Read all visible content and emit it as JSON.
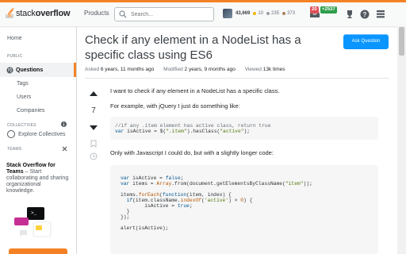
{
  "header": {
    "logo_text_plain": "stack",
    "logo_text_bold": "overflow",
    "products_label": "Products",
    "search_placeholder": "Search...",
    "reputation": "43,669",
    "gold": "10",
    "silver": "235",
    "bronze": "373",
    "inbox_badge": "20",
    "achievements_badge": "+2537",
    "colors": {
      "accent": "#f48225",
      "gold": "#f1b600",
      "silver": "#9a9ea3",
      "bronze": "#ab825f",
      "red": "#de4f54",
      "green": "#2e9e4a"
    }
  },
  "sidebar": {
    "home": "Home",
    "public_heading": "PUBLIC",
    "questions": "Questions",
    "tags": "Tags",
    "users": "Users",
    "companies": "Companies",
    "collectives_heading": "COLLECTIVES",
    "explore_collectives": "Explore Collectives",
    "teams_heading": "TEAMS",
    "teams_title": "Stack Overflow for Teams",
    "teams_desc": " – Start collaborating and sharing organizational knowledge."
  },
  "question": {
    "title": "Check if any element in a NodeList has a specific class using ES6",
    "ask_button": "Ask Question",
    "asked_label": "Asked",
    "asked_value": "6 years, 11 months ago",
    "modified_label": "Modified",
    "modified_value": "2 years, 9 months ago",
    "viewed_label": "Viewed",
    "viewed_value": "13k times",
    "score": "7",
    "p1": "I want to check if any element in a NodeList has a specific class.",
    "p2": "For example, with jQuery I just do something like:",
    "code1": {
      "comment": "//if any .item element has active class, return true",
      "line2_kw": "var",
      "line2_rest": " isActive = $(",
      "line2_str1": "\".item\"",
      "line2_mid": ").hasClass(",
      "line2_str2": "\"active\"",
      "line2_end": ");"
    },
    "p3": "Only with Javascript I could do, but with a slightly longer code:",
    "code2": {
      "l1_kw": "var",
      "l1_rest": " isActive = ",
      "l1_lit": "false",
      "l1_end": ";",
      "l2_kw": "var",
      "l2_rest": " items = ",
      "l2_fn": "Array",
      "l2_mid": ".from(document.getElementsByClassName(",
      "l2_str": "\"item\"",
      "l2_end": "));",
      "l3_a": "items.",
      "l3_fn": "forEach",
      "l3_b": "(",
      "l3_kw": "function",
      "l3_c": "(item, index) {",
      "l4_kw": "if",
      "l4_a": "(item.className.",
      "l4_fn": "indexOf",
      "l4_b": "(",
      "l4_str": "'active'",
      "l4_c": ") > ",
      "l4_num": "0",
      "l4_d": ") {",
      "l5_a": "isActive = ",
      "l5_lit": "true",
      "l5_b": ";",
      "l6": "}",
      "l7": "});",
      "l8": "alert(isActive);"
    }
  }
}
